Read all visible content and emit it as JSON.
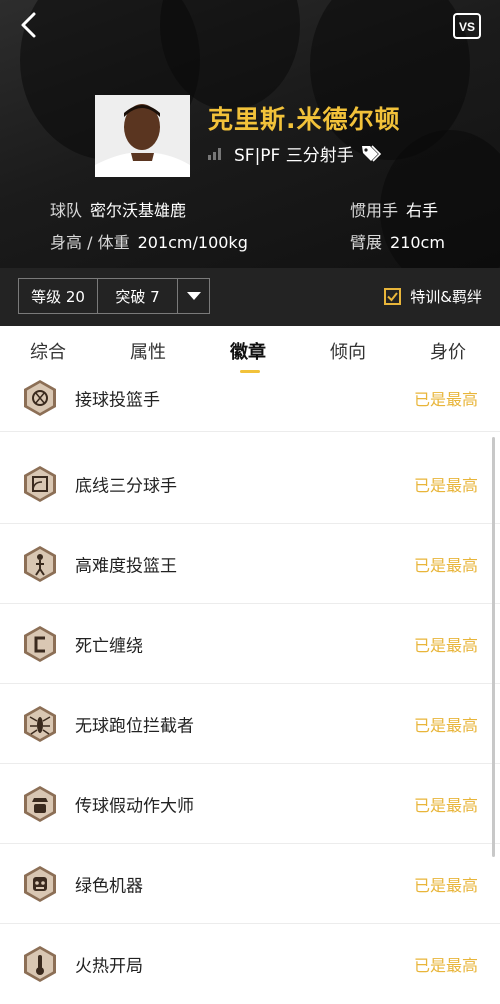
{
  "header": {
    "back_icon": "back-chevron-icon",
    "vs_label": "VS",
    "player_name": "克里斯.米德尔顿",
    "position": "SF|PF 三分射手",
    "team_label": "球队",
    "team_value": "密尔沃基雄鹿",
    "hand_label": "惯用手",
    "hand_value": "右手",
    "hw_label": "身高 / 体重",
    "hw_value": "201cm/100kg",
    "wingspan_label": "臂展",
    "wingspan_value": "210cm",
    "accent_color": "#f2c23a"
  },
  "controls": {
    "level": "等级 20",
    "breakthrough": "突破 7",
    "toggle_label": "特训&羁绊",
    "toggle_checked": true
  },
  "tabs": [
    {
      "label": "综合",
      "active": false
    },
    {
      "label": "属性",
      "active": false
    },
    {
      "label": "徽章",
      "active": true
    },
    {
      "label": "倾向",
      "active": false
    },
    {
      "label": "身价",
      "active": false
    }
  ],
  "badges": [
    {
      "name": "接球投篮手",
      "status": "已是最高",
      "icon": "catch-shoot-icon"
    },
    {
      "name": "底线三分球手",
      "status": "已是最高",
      "icon": "corner-three-icon"
    },
    {
      "name": "高难度投篮王",
      "status": "已是最高",
      "icon": "difficult-shot-icon"
    },
    {
      "name": "死亡缠绕",
      "status": "已是最高",
      "icon": "death-grip-icon"
    },
    {
      "name": "无球跑位拦截者",
      "status": "已是最高",
      "icon": "off-ball-pest-icon"
    },
    {
      "name": "传球假动作大师",
      "status": "已是最高",
      "icon": "pass-fake-icon"
    },
    {
      "name": "绿色机器",
      "status": "已是最高",
      "icon": "green-machine-icon"
    },
    {
      "name": "火热开局",
      "status": "已是最高",
      "icon": "hot-start-icon"
    }
  ]
}
